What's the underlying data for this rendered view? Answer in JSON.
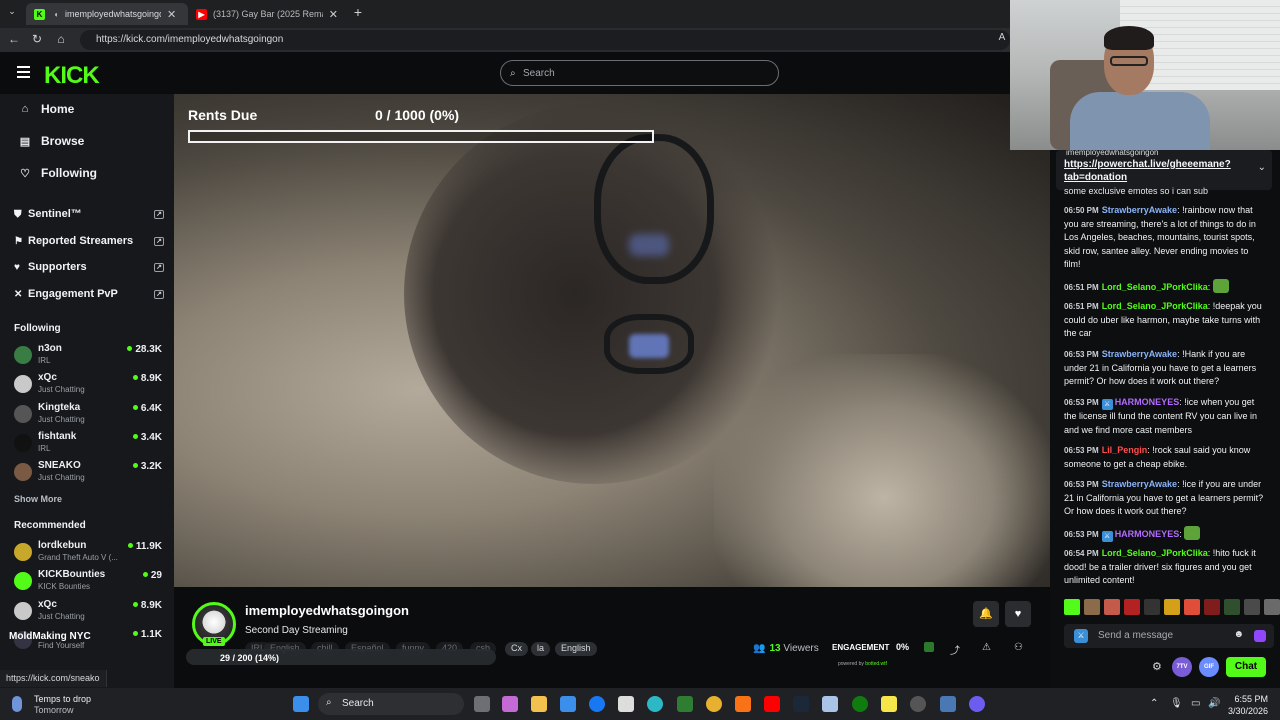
{
  "browser": {
    "tabs": [
      {
        "title": "imemployedwhatsgoingon Str",
        "favicon": "K",
        "favicon_color": "#53fc18",
        "active": true
      },
      {
        "title": "(3137) Gay Bar (2025 Remaster) -",
        "favicon": "▶",
        "favicon_color": "#ff0000",
        "active": false
      }
    ],
    "url": "https://kick.com/imemployedwhatsgoingon"
  },
  "header": {
    "logo": "KICK",
    "search_placeholder": "Search"
  },
  "sidebar": {
    "nav": [
      {
        "label": "Home",
        "icon": "home-icon"
      },
      {
        "label": "Browse",
        "icon": "browse-icon"
      },
      {
        "label": "Following",
        "icon": "heart-icon"
      }
    ],
    "tools": [
      {
        "label": "Sentinel™",
        "icon": "shield-icon"
      },
      {
        "label": "Reported Streamers",
        "icon": "flag-icon"
      },
      {
        "label": "Supporters",
        "icon": "heart-icon"
      },
      {
        "label": "Engagement PvP",
        "icon": "swords-icon"
      }
    ],
    "following_title": "Following",
    "following": [
      {
        "name": "n3on",
        "category": "IRL",
        "viewers": "28.3K",
        "avatar_color": "#3a7d44"
      },
      {
        "name": "xQc",
        "category": "Just Chatting",
        "viewers": "8.9K",
        "avatar_color": "#c9c9c9"
      },
      {
        "name": "Kingteka",
        "category": "Just Chatting",
        "viewers": "6.4K",
        "avatar_color": "#555"
      },
      {
        "name": "fishtank",
        "category": "IRL",
        "viewers": "3.4K",
        "avatar_color": "#111"
      },
      {
        "name": "SNEAKO",
        "category": "Just Chatting",
        "viewers": "3.2K",
        "avatar_color": "#7a5a44"
      }
    ],
    "show_more": "Show More",
    "recommended_title": "Recommended",
    "recommended": [
      {
        "name": "lordkebun",
        "category": "Grand Theft Auto V (...",
        "viewers": "11.9K",
        "avatar_color": "#c8a82a"
      },
      {
        "name": "KICKBounties",
        "category": "KICK Bounties",
        "viewers": "29",
        "avatar_color": "#53fc18"
      },
      {
        "name": "xQc",
        "category": "Just Chatting",
        "viewers": "8.9K",
        "avatar_color": "#c9c9c9"
      },
      {
        "name": "",
        "category": "Find Yourself",
        "viewers": "1.1K",
        "avatar_color": "#334"
      }
    ],
    "overlay_text": "MoldMaking NYC"
  },
  "video": {
    "goal_label": "Rents Due",
    "goal_value": "0 / 1000 (0%)",
    "goal_fraction": 0.0
  },
  "stream": {
    "streamer": "imemployedwhatsgoingon",
    "live": "LIVE",
    "title": "Second Day Streaming",
    "tags": [
      "IRL",
      "English",
      "chill",
      "Español",
      "funny",
      "420",
      "csb",
      "Cx",
      "la",
      "English"
    ],
    "viewers_count": "13",
    "viewers_label": "Viewers",
    "engagement_label": "ENGAGEMENT",
    "engagement_value": "0%",
    "powered_by": "powered by",
    "powered_brand": "botted.wtf",
    "sub_goal_text": "29 / 200 (14%)",
    "sub_goal_fraction": 0.14
  },
  "status_url": "https://kick.com/sneako",
  "chat": {
    "pinned_user": "imemployedwhatsgoingon",
    "pinned_link": "https://powerchat.live/gheeemane?tab=donation",
    "pinned_tail": "some exclusive emotes so i can sub",
    "messages": [
      {
        "time": "06:50 PM",
        "user": "StrawberryAwake",
        "color": "#8ab4f8",
        "badge": false,
        "text": "!rainbow now that you are streaming, there's a lot of things to do in Los Angeles, beaches, mountains, tourist spots, skid row, santee alley. Never ending movies to film!"
      },
      {
        "time": "06:51 PM",
        "user": "Lord_Selano_JPorkClika",
        "color": "#53fc18",
        "badge": false,
        "text": "",
        "emote": true
      },
      {
        "time": "06:51 PM",
        "user": "Lord_Selano_JPorkClika",
        "color": "#53fc18",
        "badge": false,
        "text": "!deepak you could do uber like harmon, maybe take turns with the car"
      },
      {
        "time": "06:53 PM",
        "user": "StrawberryAwake",
        "color": "#8ab4f8",
        "badge": false,
        "text": "!Hank if you are under 21 in California you have to get a learners permit? Or how does it work out there?"
      },
      {
        "time": "06:53 PM",
        "user": "HARMONEYES",
        "color": "#b36bff",
        "badge": true,
        "text": "!ice when you get the license ill fund the content RV you can live in and we find more cast members"
      },
      {
        "time": "06:53 PM",
        "user": "Lil_Pengin",
        "color": "#ff4d4d",
        "badge": false,
        "text": "!rock saul said you know someone to get a cheap ebike."
      },
      {
        "time": "06:53 PM",
        "user": "StrawberryAwake",
        "color": "#8ab4f8",
        "badge": false,
        "text": "!ice if you are under 21 in California you have to get a learners permit? Or how does it work out there?"
      },
      {
        "time": "06:53 PM",
        "user": "HARMONEYES",
        "color": "#b36bff",
        "badge": true,
        "text": "",
        "emote": true
      },
      {
        "time": "06:54 PM",
        "user": "Lord_Selano_JPorkClika",
        "color": "#53fc18",
        "badge": false,
        "text": "!hito fuck it dood! be a trailer driver! six figures and you get unlimited content!"
      }
    ],
    "send_placeholder": "Send a message",
    "chat_button": "Chat",
    "pills": [
      "7TV",
      "GIF"
    ]
  },
  "taskbar": {
    "weather_line1": "Temps to drop",
    "weather_line2": "Tomorrow",
    "search_label": "Search",
    "time": "6:55 PM",
    "date": "3/30/2026"
  }
}
